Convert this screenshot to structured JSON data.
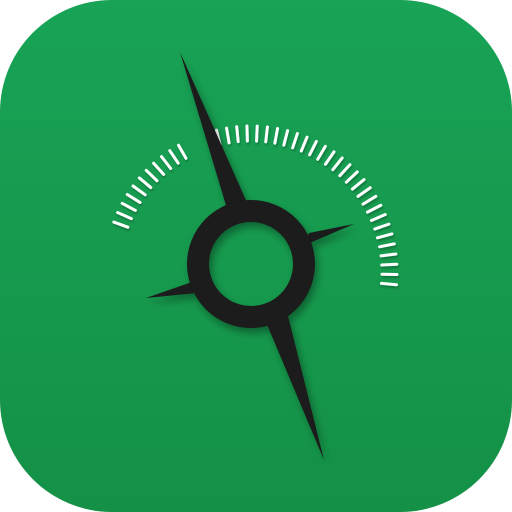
{
  "app_icon": {
    "name": "compass-app-icon",
    "icon": "compass-icon",
    "background_color": "#18a356",
    "background_color_dark": "#149146",
    "needle_color": "#1a1a1a",
    "tick_color": "#ffffff"
  }
}
